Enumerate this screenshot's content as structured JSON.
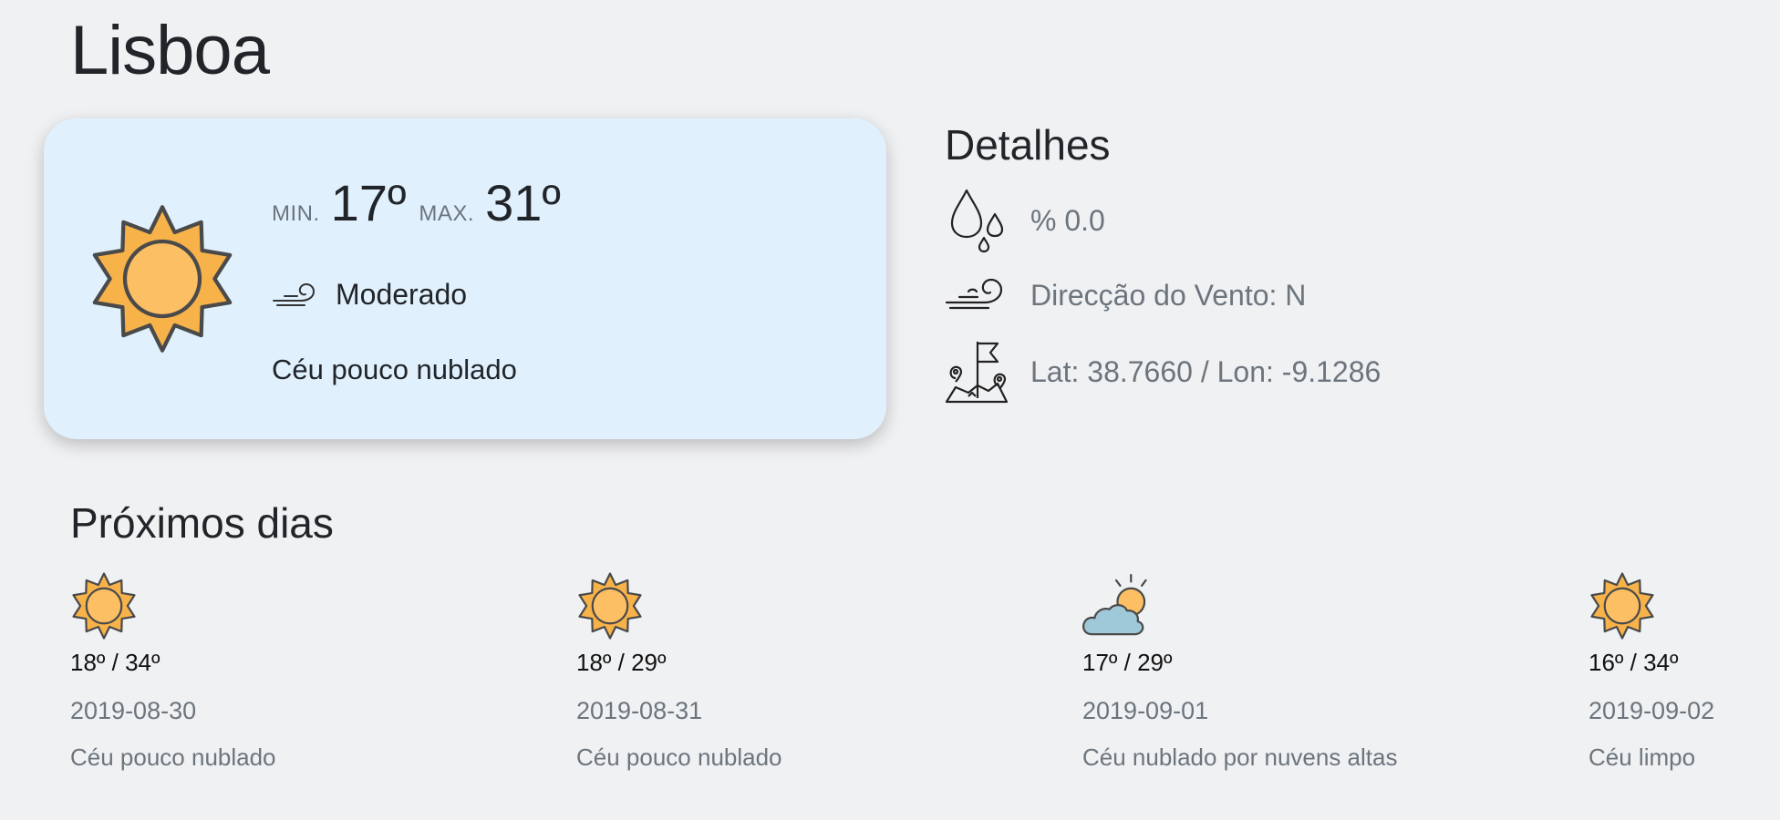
{
  "city": "Lisboa",
  "current": {
    "min_label": "MIN.",
    "min_value": "17º",
    "max_label": "MAX.",
    "max_value": "31º",
    "wind_intensity": "Moderado",
    "description": "Céu pouco nublado",
    "icon": "sun-icon"
  },
  "details": {
    "title": "Detalhes",
    "precipitation": "% 0.0",
    "wind_direction": "Direcção do Vento: N",
    "coordinates": "Lat: 38.7660 / Lon: -9.1286"
  },
  "forecast": {
    "title": "Próximos dias",
    "days": [
      {
        "range": "18º / 34º",
        "date": "2019-08-30",
        "description": "Céu pouco nublado",
        "icon": "sun-icon"
      },
      {
        "range": "18º / 29º",
        "date": "2019-08-31",
        "description": "Céu pouco nublado",
        "icon": "sun-icon"
      },
      {
        "range": "17º / 29º",
        "date": "2019-09-01",
        "description": "Céu nublado por nuvens altas",
        "icon": "cloud-sun-icon"
      },
      {
        "range": "16º / 34º",
        "date": "2019-09-02",
        "description": "Céu limpo",
        "icon": "sun-icon"
      }
    ]
  },
  "colors": {
    "background": "#f0f1f3",
    "card": "#e0f1fd",
    "sun_fill": "#f7b24a",
    "sun_core": "#fcbf64",
    "outline": "#4a4a4a",
    "cloud": "#9fc9d8",
    "muted_text": "#6c757d"
  }
}
